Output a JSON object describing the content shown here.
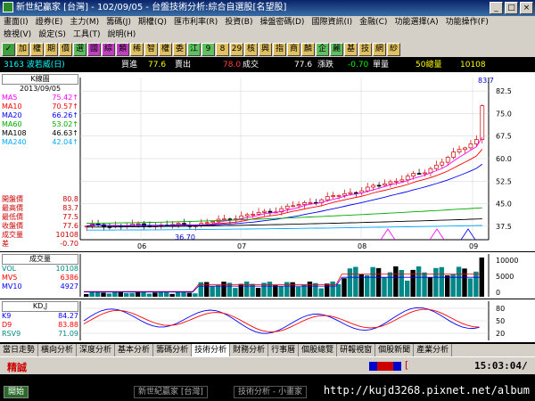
{
  "titlebar": {
    "text": "新世紀贏家 [台灣] - 102/09/05 - 台盤技術分析:綜合自選股[名望股]"
  },
  "menu": {
    "row1": [
      "畫面(I)",
      "證券(E)",
      "主力(M)",
      "籌碼(J)",
      "期權(Q)",
      "匯市利率(R)",
      "投資(B)",
      "操盤密碼(D)",
      "國際資訊(I)",
      "金融(C)",
      "功能選擇(A)",
      "功能操作(F)"
    ],
    "row2": [
      "檢視(V)",
      "設定(S)",
      "工具(T)",
      "說明(H)"
    ]
  },
  "toolbar": {
    "icons": [
      "✓",
      "加",
      "權",
      "期",
      "價",
      "選",
      "國",
      "綜",
      "類",
      "稀",
      "智",
      "權",
      "委",
      "江",
      "9",
      "8",
      "29",
      "核",
      "興",
      "指",
      "商",
      "麟",
      "企",
      "麗",
      "基",
      "技",
      "網",
      "紗"
    ]
  },
  "quote": {
    "stock": "3163 波若威(日)",
    "bid_label": "買進",
    "bid": "77.6",
    "ask_label": "賣出",
    "ask": "78.0",
    "deal_label": "成交",
    "deal": "77.6",
    "chg_label": "漲跌",
    "chg": "-0.70",
    "vol_label": "單量",
    "vol": "50總量",
    "total": "10108"
  },
  "kline": {
    "header": "K線圖",
    "date": "2013/09/05",
    "ma": [
      {
        "label": "MA5",
        "value": "75.42↑",
        "color": "#ff00ff"
      },
      {
        "label": "MA10",
        "value": "70.57↑",
        "color": "#ff0000"
      },
      {
        "label": "MA20",
        "value": "66.26↑",
        "color": "#0000ff"
      },
      {
        "label": "MA60",
        "value": "53.02↑",
        "color": "#00aa00"
      },
      {
        "label": "MA108",
        "value": "46.63↑",
        "color": "#000000"
      },
      {
        "label": "MA240",
        "value": "42.04↑",
        "color": "#00aaff"
      }
    ],
    "ohlc": [
      {
        "label": "開盤價",
        "value": "80.8"
      },
      {
        "label": "最高價",
        "value": "83.7"
      },
      {
        "label": "最低價",
        "value": "77.5"
      },
      {
        "label": "收盤價",
        "value": "77.6"
      },
      {
        "label": "成交量",
        "value": "10108"
      },
      {
        "label": "差",
        "value": "-0.70"
      }
    ],
    "yticks": [
      "82.5",
      "75.0",
      "67.5",
      "60.0",
      "52.5",
      "45.0",
      "37.5"
    ],
    "high_label": "83.7",
    "low_label": "36.70",
    "xticks": [
      "06",
      "07",
      "08",
      "09"
    ]
  },
  "volume": {
    "header": "成交量",
    "rows": [
      {
        "label": "VOL",
        "value": "10108",
        "color": "#008888"
      },
      {
        "label": "MV5",
        "value": "6386",
        "color": "#ff0000"
      },
      {
        "label": "MV10",
        "value": "4927",
        "color": "#0000ff"
      }
    ],
    "yticks": [
      "10000",
      "5000",
      "0"
    ]
  },
  "kd": {
    "header": "KD,J",
    "rows": [
      {
        "label": "K9",
        "value": "84.27",
        "color": "#0000ff"
      },
      {
        "label": "D9",
        "value": "83.88",
        "color": "#ff0000"
      },
      {
        "label": "RSV9",
        "value": "71.09",
        "color": "#008888"
      }
    ],
    "yticks": [
      "80",
      "50",
      "20"
    ]
  },
  "bottom_tabs": [
    "當日走勢",
    "橫向分析",
    "深度分析",
    "基本分析",
    "籌碼分析",
    "技術分析",
    "財務分析",
    "行事曆",
    "個股總覽",
    "研報視窗",
    "個股新聞",
    "產業分析"
  ],
  "status": {
    "left": "精誠",
    "bracket": "[",
    "clock": "15:03:04/"
  },
  "taskbar": {
    "start": "開始",
    "items": [
      "新世紀贏家 [台灣]",
      "技術分析 - 小畫家"
    ],
    "url": "http://kujd3268.pixnet.net/album"
  }
}
